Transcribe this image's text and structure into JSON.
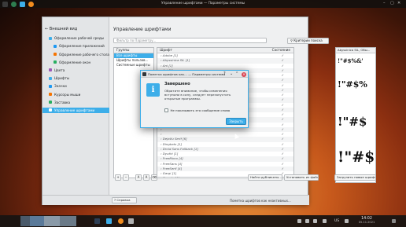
{
  "window_title": "Управление шрифтами — Параметры системы",
  "sidebar": {
    "header": "Внешний вид",
    "items": [
      {
        "label": "Оформление рабочей среды",
        "sub": false
      },
      {
        "label": "Оформление приложений",
        "sub": true
      },
      {
        "label": "Оформление рабочего стола",
        "sub": true
      },
      {
        "label": "Оформление окон",
        "sub": true
      },
      {
        "label": "Цвета",
        "sub": false
      },
      {
        "label": "Шрифты",
        "sub": false
      },
      {
        "label": "Значки",
        "sub": false
      },
      {
        "label": "Курсоры мыши",
        "sub": false
      },
      {
        "label": "Заставка",
        "sub": false
      },
      {
        "label": "Управление шрифтами",
        "sub": false,
        "selected": true
      }
    ],
    "highlight_label": "Выделить изменённые параметры"
  },
  "main": {
    "title": "Управление шрифтами",
    "search_placeholder": "Фильтр по Параметру...",
    "criteria_label": "Критерии поиска",
    "groups_header": "Группы",
    "groups": [
      "Все шрифты",
      "Шрифты пользов...",
      "Системные шрифты"
    ],
    "fonts_header": "Шрифт",
    "status_header": "Состояние",
    "fonts": [
      "Adobe [1]",
      "Abyssinica SIL [1]",
      "Ani [1]",
      "Ani [1]",
      "",
      "",
      "",
      "",
      "",
      "",
      "",
      "",
      "",
      "",
      "",
      "",
      "",
      "DejaVu Serif [6]",
      "Dingbats [1]",
      "Droid Sans Fallback [1]",
      "Dyuthi [1]",
      "FreeMono [4]",
      "FreeSans [4]",
      "FreeSerif [4]",
      "Gargi [1]",
      "Garuda [4]"
    ],
    "preview_header": "Abyssinica SIL, Обы...",
    "preview_samples": [
      "!\"#$%&'",
      "!\"#$%",
      "!\"#$",
      "!\"#$"
    ],
    "find_duplicates": "Найти дубликаты...",
    "install_from_file": "Установить из файла...",
    "download_new": "Загрузить новые шрифты...",
    "status_hint": "Пометка шрифтов как неактивных..."
  },
  "footer": {
    "help": "Справка"
  },
  "dialog": {
    "title": "Пометка шрифтов как… — Параметры системы",
    "heading": "Завершено",
    "body": "Обратите внимание, чтобы изменения вступили в силу, следует перезапустить открытые программы.",
    "checkbox_label": "Не показывать это сообщение снова",
    "ok_label": "Закрыть"
  },
  "taskbar": {
    "time": "14:02",
    "date": "05.11.2021",
    "lang": "US"
  },
  "colors": {
    "accent": "#3daee9",
    "window_bg": "#eff0f1"
  }
}
